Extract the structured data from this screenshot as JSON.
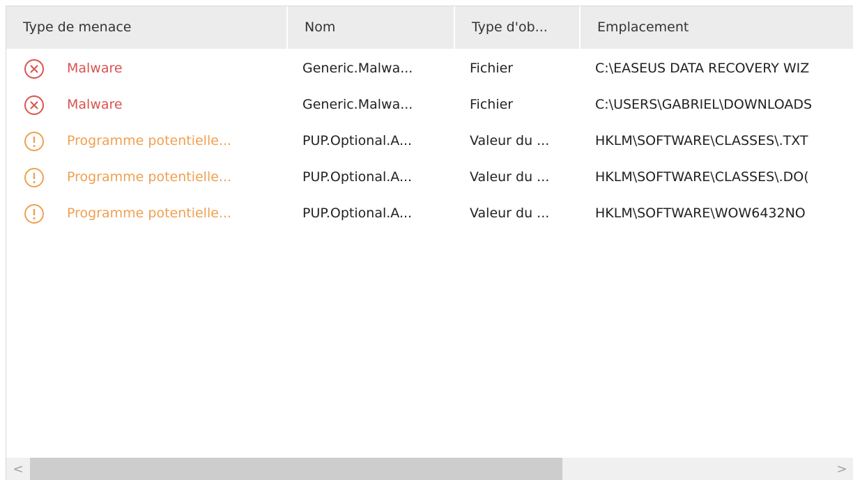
{
  "columns": [
    {
      "label": "Type de menace"
    },
    {
      "label": "Nom"
    },
    {
      "label": "Type d'ob..."
    },
    {
      "label": "Emplacement"
    }
  ],
  "rows": [
    {
      "severity": "error",
      "color": "#d9534f",
      "threat_type": "Malware",
      "name": "Generic.Malwa...",
      "object_type": "Fichier",
      "location": "C:\\EASEUS DATA RECOVERY WIZ"
    },
    {
      "severity": "error",
      "color": "#d9534f",
      "threat_type": "Malware",
      "name": "Generic.Malwa...",
      "object_type": "Fichier",
      "location": "C:\\USERS\\GABRIEL\\DOWNLOADS"
    },
    {
      "severity": "warning",
      "color": "#f0a050",
      "threat_type": "Programme potentielle...",
      "name": "PUP.Optional.A...",
      "object_type": "Valeur du ...",
      "location": "HKLM\\SOFTWARE\\CLASSES\\.TXT"
    },
    {
      "severity": "warning",
      "color": "#f0a050",
      "threat_type": "Programme potentielle...",
      "name": "PUP.Optional.A...",
      "object_type": "Valeur du ...",
      "location": "HKLM\\SOFTWARE\\CLASSES\\.DO("
    },
    {
      "severity": "warning",
      "color": "#f0a050",
      "threat_type": "Programme potentielle...",
      "name": "PUP.Optional.A...",
      "object_type": "Valeur du ...",
      "location": "HKLM\\SOFTWARE\\WOW6432NO"
    }
  ],
  "scrollbar": {
    "left_arrow": "<",
    "right_arrow": ">",
    "position": 0
  }
}
